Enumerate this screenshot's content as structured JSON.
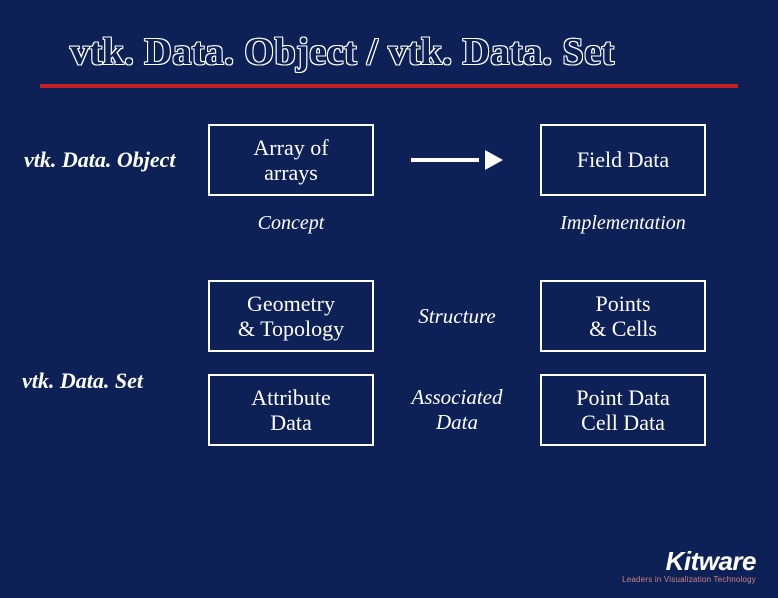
{
  "title": "vtk. Data. Object / vtk. Data. Set",
  "labels": {
    "dataObject": "vtk. Data. Object",
    "dataSet": "vtk. Data. Set"
  },
  "columns": {
    "concept": "Concept",
    "implementation": "Implementation"
  },
  "rows": [
    {
      "concept": "Array of arrays",
      "mid": "__arrow__",
      "impl": "Field Data"
    },
    {
      "concept": "Geometry & Topology",
      "mid": "Structure",
      "impl": "Points & Cells"
    },
    {
      "concept": "Attribute Data",
      "mid": "Associated Data",
      "impl": "Point Data Cell Data"
    }
  ],
  "logo": {
    "main": "Kitware",
    "sub": "Leaders in Visualization Technology"
  }
}
